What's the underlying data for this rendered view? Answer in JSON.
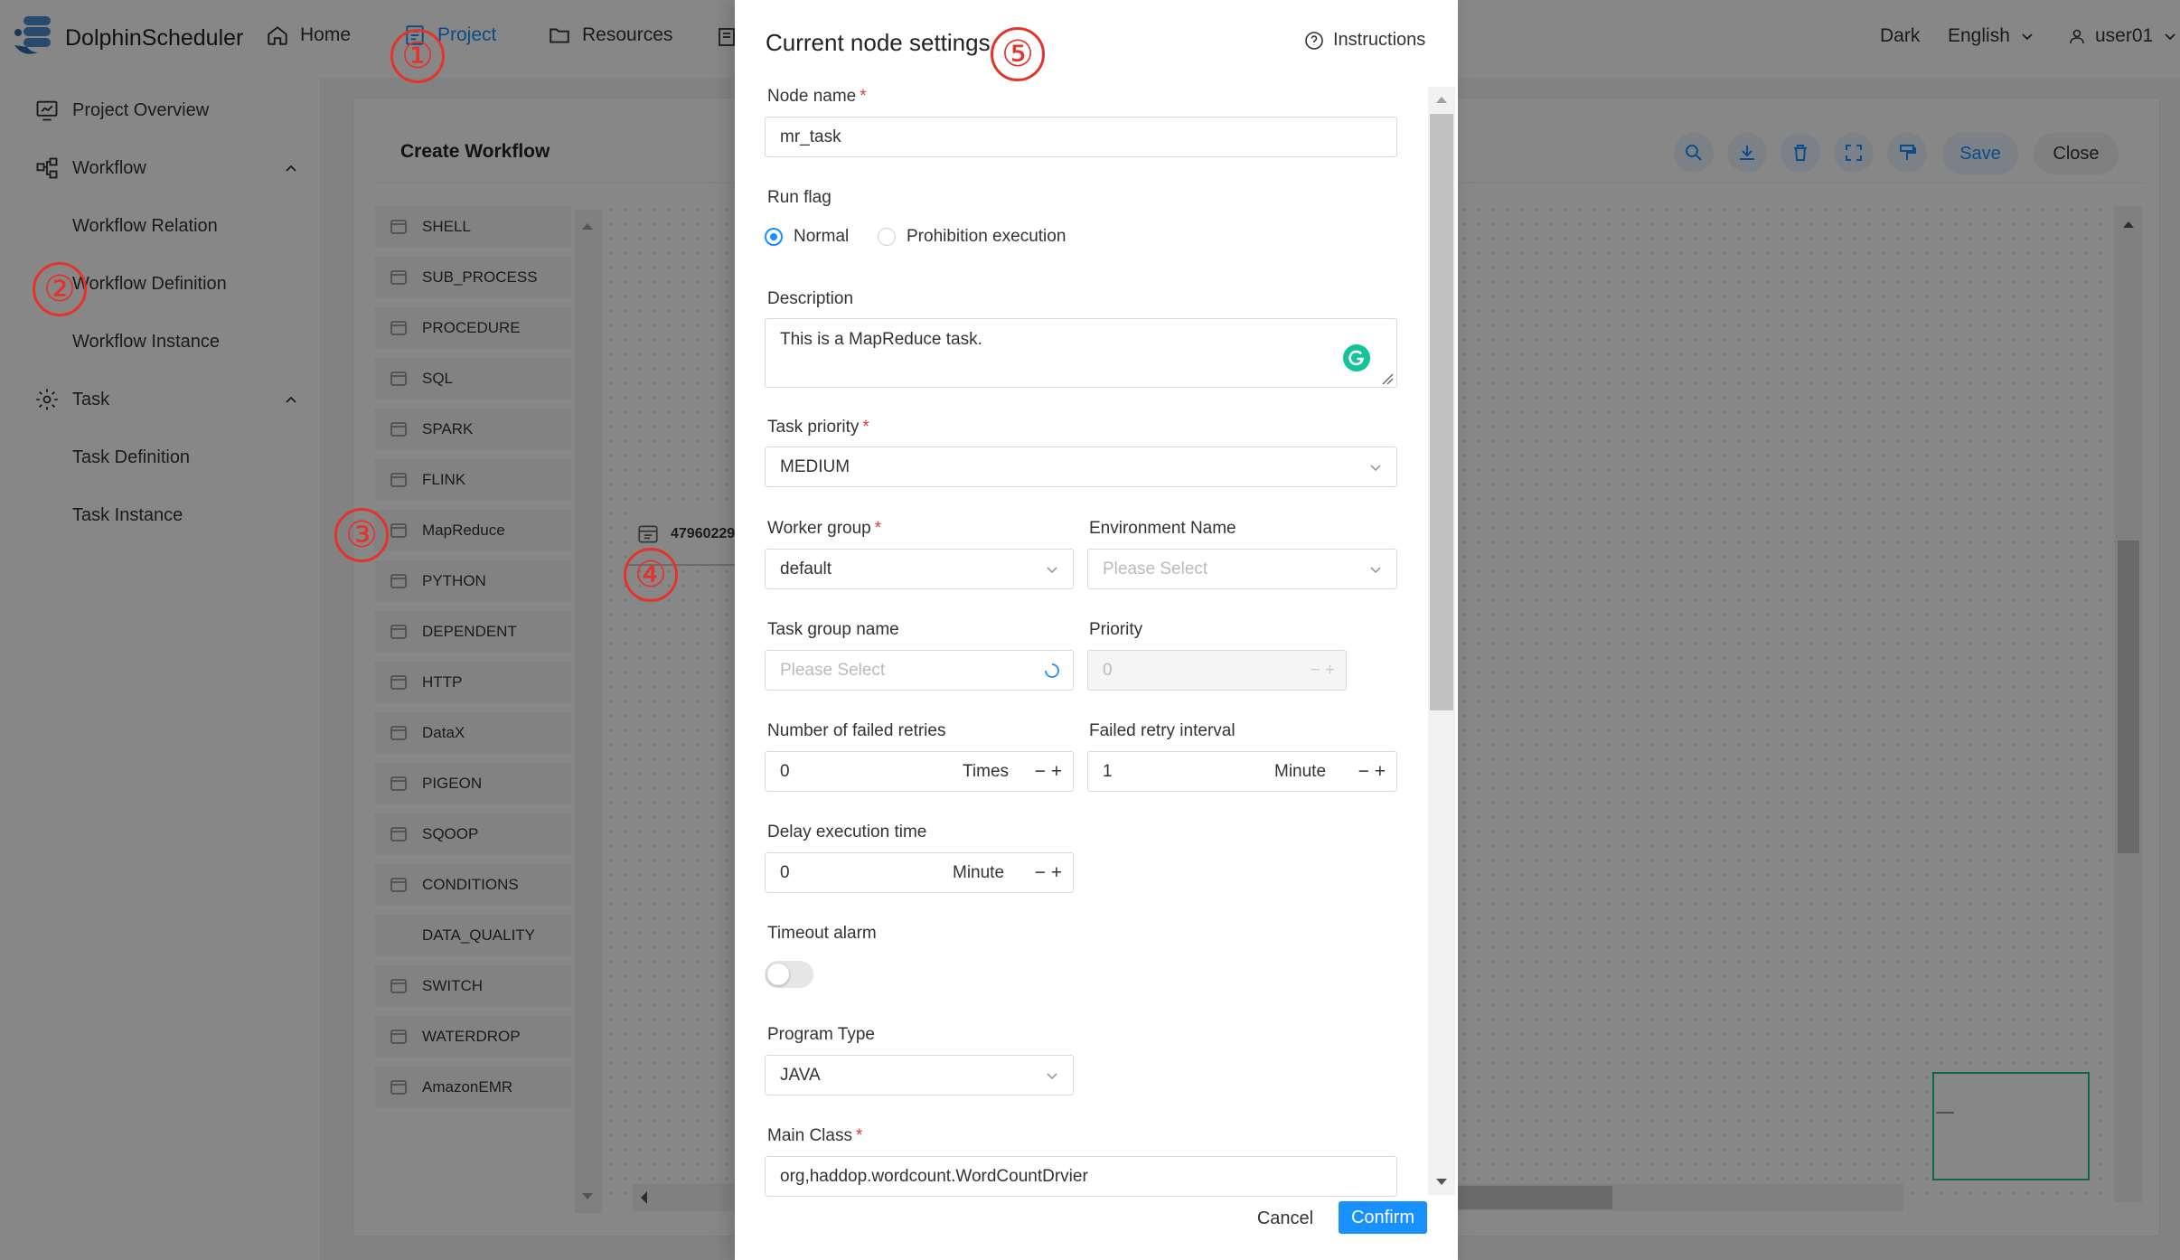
{
  "app": {
    "name": "DolphinScheduler"
  },
  "nav": {
    "home": "Home",
    "project": "Project",
    "resources": "Resources",
    "theme": "Dark",
    "language": "English",
    "user": "user01"
  },
  "sidebar": {
    "items": [
      {
        "label": "Project Overview"
      },
      {
        "label": "Workflow"
      },
      {
        "label": "Workflow Relation"
      },
      {
        "label": "Workflow Definition"
      },
      {
        "label": "Workflow Instance"
      },
      {
        "label": "Task"
      },
      {
        "label": "Task Definition"
      },
      {
        "label": "Task Instance"
      }
    ]
  },
  "workflow": {
    "title": "Create Workflow",
    "save": "Save",
    "close": "Close",
    "node_id": "47960229",
    "palette": [
      "SHELL",
      "SUB_PROCESS",
      "PROCEDURE",
      "SQL",
      "SPARK",
      "FLINK",
      "MapReduce",
      "PYTHON",
      "DEPENDENT",
      "HTTP",
      "DataX",
      "PIGEON",
      "SQOOP",
      "CONDITIONS",
      "DATA_QUALITY",
      "SWITCH",
      "WATERDROP",
      "AmazonEMR"
    ]
  },
  "annotations": [
    "①",
    "②",
    "③",
    "④",
    "⑤"
  ],
  "drawer": {
    "title": "Current node settings",
    "instructions": "Instructions",
    "node_name": {
      "label": "Node name",
      "value": "mr_task"
    },
    "run_flag": {
      "label": "Run flag",
      "normal": "Normal",
      "prohibition": "Prohibition execution"
    },
    "description": {
      "label": "Description",
      "value": "This is a MapReduce task."
    },
    "task_priority": {
      "label": "Task priority",
      "value": "MEDIUM"
    },
    "worker_group": {
      "label": "Worker group",
      "value": "default"
    },
    "environment": {
      "label": "Environment Name",
      "placeholder": "Please Select"
    },
    "task_group": {
      "label": "Task group name",
      "placeholder": "Please Select"
    },
    "priority": {
      "label": "Priority",
      "value": "0"
    },
    "failed_retries": {
      "label": "Number of failed retries",
      "value": "0",
      "unit": "Times"
    },
    "retry_interval": {
      "label": "Failed retry interval",
      "value": "1",
      "unit": "Minute"
    },
    "delay_time": {
      "label": "Delay execution time",
      "value": "0",
      "unit": "Minute"
    },
    "timeout_alarm": {
      "label": "Timeout alarm"
    },
    "program_type": {
      "label": "Program Type",
      "value": "JAVA"
    },
    "main_class": {
      "label": "Main Class",
      "value": "org,haddop.wordcount.WordCountDrvier"
    },
    "cancel": "Cancel",
    "confirm": "Confirm"
  },
  "colors": {
    "primary": "#1890ff",
    "annotation": "#e4332a",
    "success": "#15c39a"
  }
}
